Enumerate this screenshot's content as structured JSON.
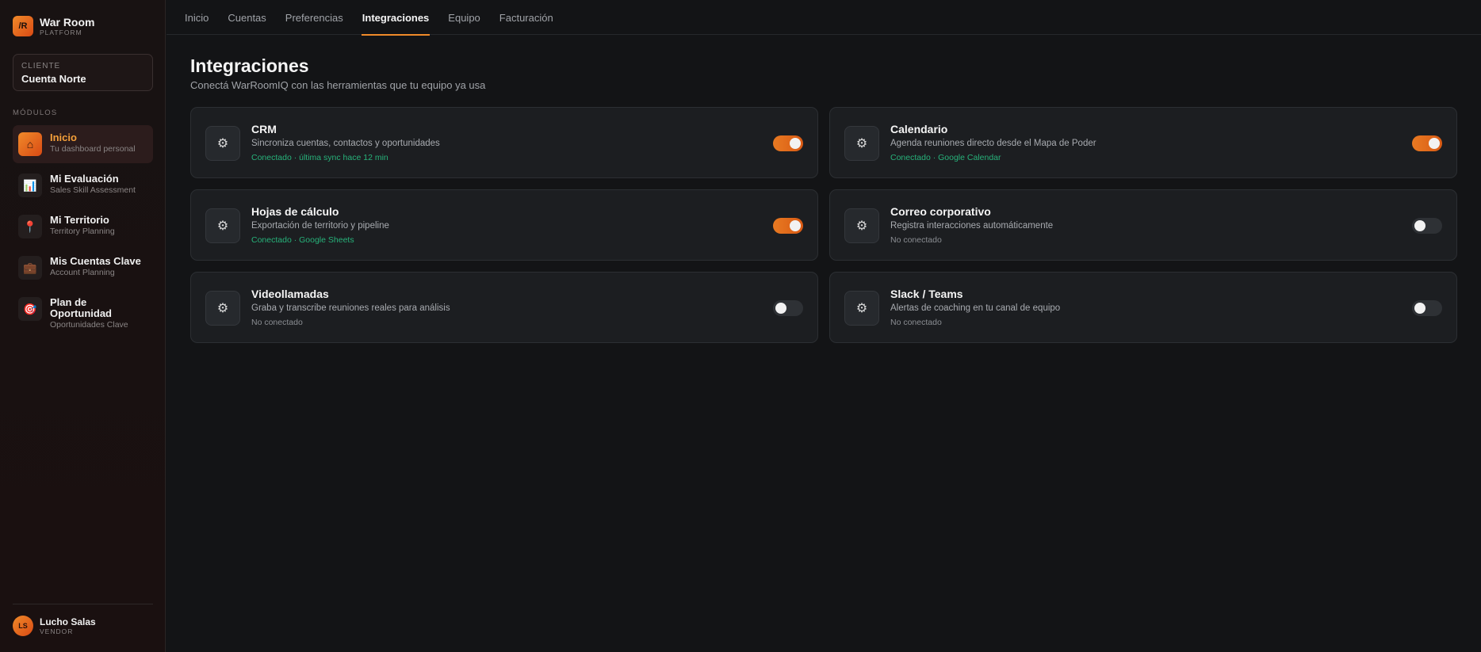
{
  "brand": {
    "logo": "/R",
    "title": "War Room",
    "subtitle": "PLATFORM"
  },
  "client": {
    "label": "CLIENTE",
    "value": "Cuenta Norte"
  },
  "sidebar": {
    "section_label": "MÓDULOS",
    "items": [
      {
        "title": "Inicio",
        "subtitle": "Tu dashboard personal",
        "icon": "home-icon",
        "glyph": "⌂"
      },
      {
        "title": "Mi Evaluación",
        "subtitle": "Sales Skill Assessment",
        "icon": "bar-chart-icon",
        "glyph": "📊"
      },
      {
        "title": "Mi Territorio",
        "subtitle": "Territory Planning",
        "icon": "pin-icon",
        "glyph": "📍"
      },
      {
        "title": "Mis Cuentas Clave",
        "subtitle": "Account Planning",
        "icon": "briefcase-icon",
        "glyph": "💼"
      },
      {
        "title": "Plan de Oportunidad",
        "subtitle": "Oportunidades Clave",
        "icon": "target-icon",
        "glyph": "🎯"
      }
    ]
  },
  "user": {
    "initials": "LS",
    "name": "Lucho Salas",
    "role": "VENDOR"
  },
  "topnav": {
    "tabs": [
      "Inicio",
      "Cuentas",
      "Preferencias",
      "Integraciones",
      "Equipo",
      "Facturación"
    ],
    "active": "Integraciones"
  },
  "page": {
    "title": "Integraciones",
    "subtitle": "Conectá WarRoomIQ con las herramientas que tu equipo ya usa"
  },
  "integrations": [
    {
      "title": "CRM",
      "desc": "Sincroniza cuentas, contactos y oportunidades",
      "status": "Conectado · última sync hace 12 min",
      "connected": true
    },
    {
      "title": "Calendario",
      "desc": "Agenda reuniones directo desde el Mapa de Poder",
      "status": "Conectado · Google Calendar",
      "connected": true
    },
    {
      "title": "Hojas de cálculo",
      "desc": "Exportación de territorio y pipeline",
      "status": "Conectado · Google Sheets",
      "connected": true
    },
    {
      "title": "Correo corporativo",
      "desc": "Registra interacciones automáticamente",
      "status": "No conectado",
      "connected": false
    },
    {
      "title": "Videollamadas",
      "desc": "Graba y transcribe reuniones reales para análisis",
      "status": "No conectado",
      "connected": false
    },
    {
      "title": "Slack / Teams",
      "desc": "Alertas de coaching en tu canal de equipo",
      "status": "No conectado",
      "connected": false
    }
  ],
  "icons": {
    "integration": "gear-icon",
    "integration_glyph": "⚙"
  },
  "colors": {
    "accent": "#f08a2a",
    "connected": "#27b27a",
    "background": "#131416"
  }
}
